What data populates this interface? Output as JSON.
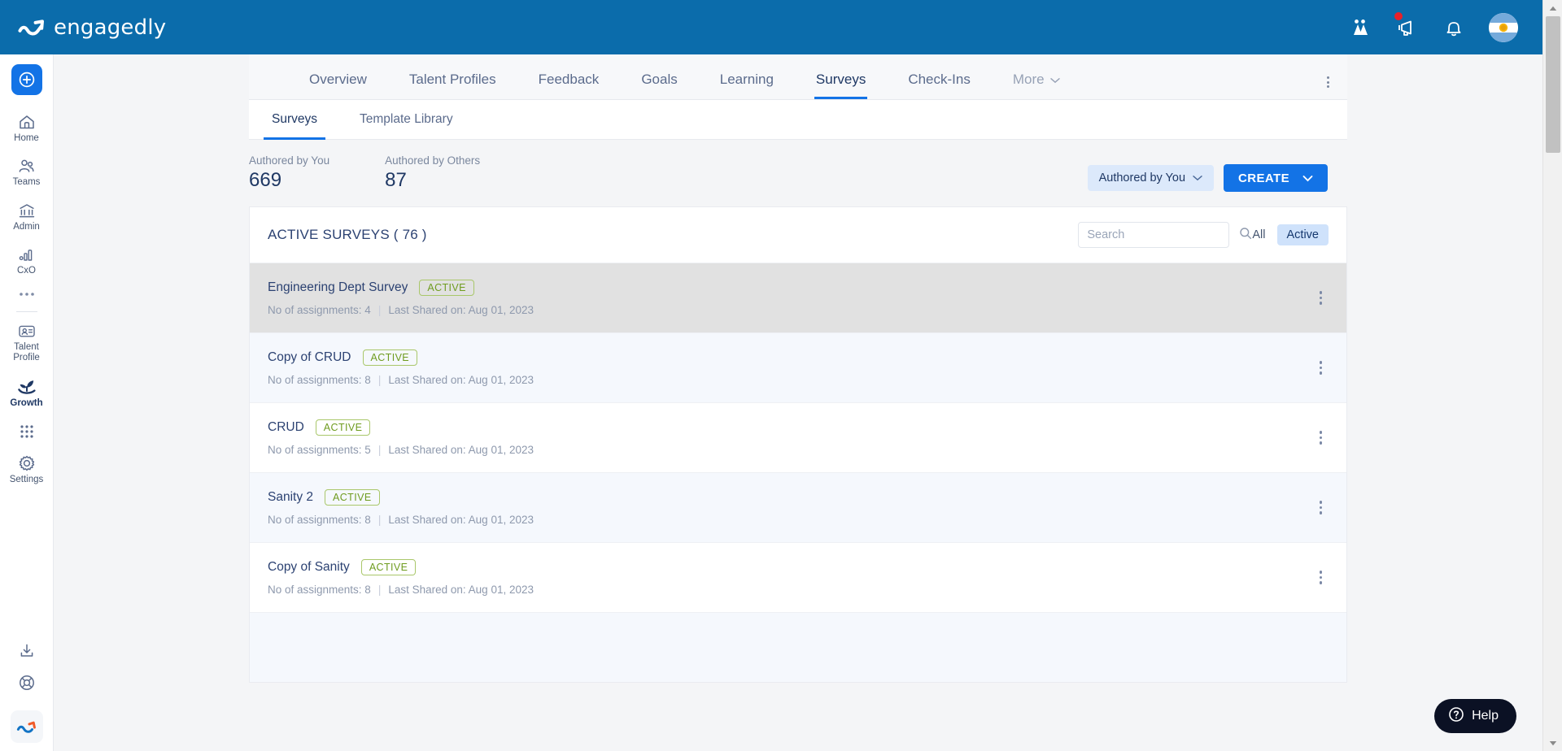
{
  "brand": {
    "name": "engagedly"
  },
  "topbar": {
    "icons": [
      {
        "name": "teams-people-icon",
        "label": "Teams"
      },
      {
        "name": "megaphone-icon",
        "label": "Announcements",
        "badge": true
      },
      {
        "name": "bell-icon",
        "label": "Notifications"
      }
    ],
    "avatar_label": "User profile",
    "colors": {
      "bar": "#0b6cab",
      "badge_dot": "#e8202a"
    }
  },
  "sidebar": {
    "add_label": "Create",
    "items": [
      {
        "label": "Home",
        "icon": "home-icon",
        "active": false
      },
      {
        "label": "Teams",
        "icon": "teams-icon",
        "active": false
      },
      {
        "label": "Admin",
        "icon": "bank-icon",
        "active": false
      },
      {
        "label": "CxO",
        "icon": "bar-chart-icon",
        "active": false
      },
      {
        "label": "",
        "icon": "more-dots-icon",
        "active": false
      }
    ],
    "items2": [
      {
        "label": "Talent Profile",
        "icon": "id-card-icon",
        "active": false
      },
      {
        "label": "Growth",
        "icon": "growth-plant-icon",
        "active": true
      },
      {
        "label": "",
        "icon": "apps-grid-icon",
        "active": false
      },
      {
        "label": "Settings",
        "icon": "gear-icon",
        "active": false
      }
    ],
    "bottom": [
      {
        "label": "",
        "icon": "download-icon"
      },
      {
        "label": "",
        "icon": "lifering-support-icon"
      }
    ],
    "logo_label": "engagedly-logo-mark"
  },
  "nav": {
    "tabs": [
      {
        "label": "Overview",
        "active": false
      },
      {
        "label": "Talent Profiles",
        "active": false
      },
      {
        "label": "Feedback",
        "active": false
      },
      {
        "label": "Goals",
        "active": false
      },
      {
        "label": "Learning",
        "active": false
      },
      {
        "label": "Surveys",
        "active": true
      },
      {
        "label": "Check-Ins",
        "active": false
      }
    ],
    "more_label": "More",
    "overflow_label": "More options"
  },
  "subtabs": [
    {
      "label": "Surveys",
      "active": true
    },
    {
      "label": "Template Library",
      "active": false
    }
  ],
  "stats": [
    {
      "key": "Authored by You",
      "value": "669"
    },
    {
      "key": "Authored by Others",
      "value": "87"
    }
  ],
  "actions": {
    "filter_label": "Authored by You",
    "create_label": "CREATE"
  },
  "list": {
    "title": "ACTIVE SURVEYS ( 76 )",
    "search_placeholder": "Search",
    "search_value": "",
    "segments": [
      {
        "label": "All",
        "on": false
      },
      {
        "label": "Active",
        "on": true
      }
    ],
    "rows": [
      {
        "name": "Engineering Dept Survey",
        "status": "ACTIVE",
        "assignments": "No of assignments: 4",
        "shared": "Last Shared on: Aug 01, 2023",
        "state": "hover"
      },
      {
        "name": "Copy of CRUD",
        "status": "ACTIVE",
        "assignments": "No of assignments: 8",
        "shared": "Last Shared on: Aug 01, 2023",
        "state": "stripe"
      },
      {
        "name": "CRUD",
        "status": "ACTIVE",
        "assignments": "No of assignments: 5",
        "shared": "Last Shared on: Aug 01, 2023",
        "state": "plain"
      },
      {
        "name": "Sanity 2",
        "status": "ACTIVE",
        "assignments": "No of assignments: 8",
        "shared": "Last Shared on: Aug 01, 2023",
        "state": "stripe"
      },
      {
        "name": "Copy of Sanity",
        "status": "ACTIVE",
        "assignments": "No of assignments: 8",
        "shared": "Last Shared on: Aug 01, 2023",
        "state": "plain"
      }
    ]
  },
  "help": {
    "label": "Help"
  },
  "colors": {
    "accent": "#1373e6",
    "brand_bar": "#0b6cab",
    "badge_green": "#6f9c1f",
    "text_dark": "#1f3864"
  }
}
